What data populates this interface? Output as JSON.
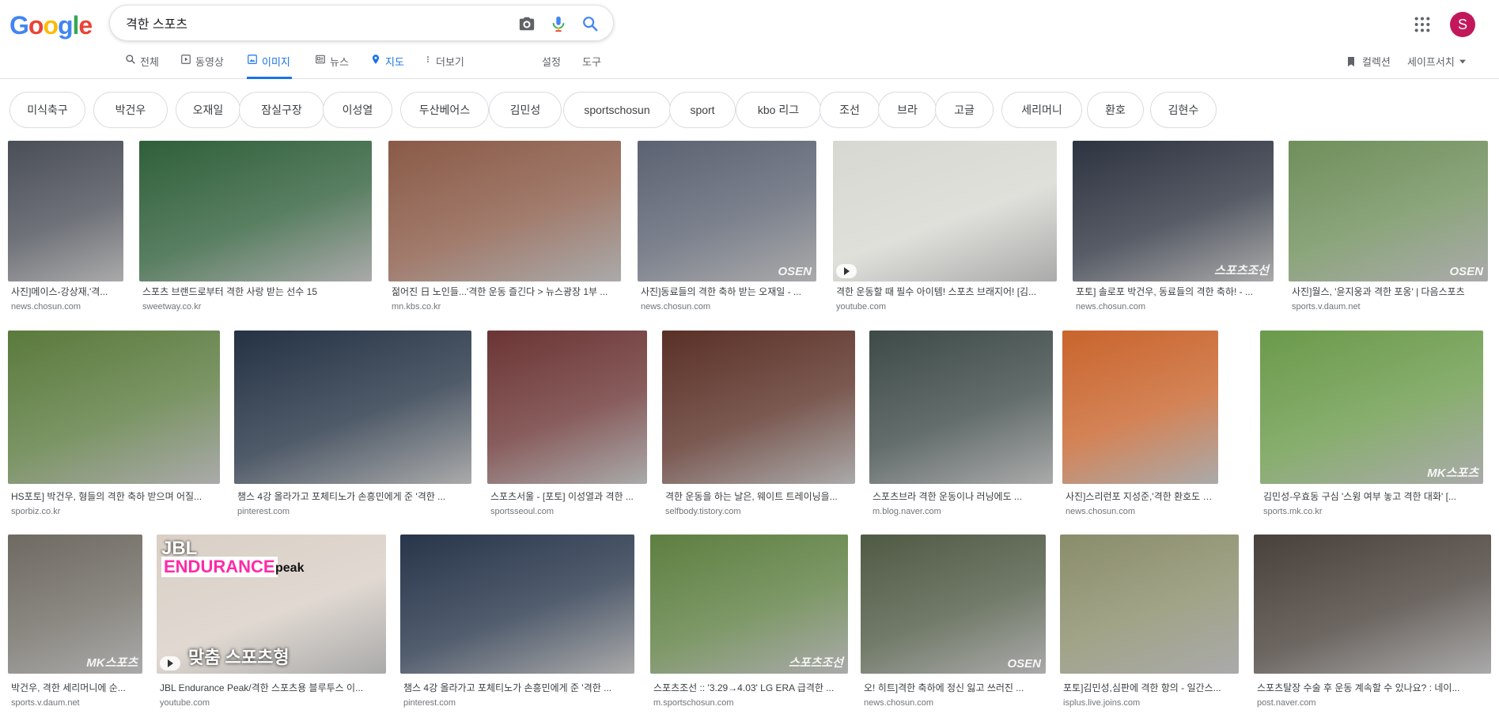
{
  "logo": [
    "G",
    "o",
    "o",
    "g",
    "l",
    "e"
  ],
  "search": {
    "query": "격한 스포츠"
  },
  "avatar_letter": "S",
  "tabs": [
    {
      "label": "전체",
      "icon": "search-icon"
    },
    {
      "label": "동영상",
      "icon": "video-icon"
    },
    {
      "label": "이미지",
      "icon": "image-icon",
      "active": true
    },
    {
      "label": "뉴스",
      "icon": "news-icon"
    },
    {
      "label": "지도",
      "icon": "map-pin-icon"
    },
    {
      "label": "더보기",
      "icon": "more-vert-icon"
    },
    {
      "label": "설정"
    },
    {
      "label": "도구"
    }
  ],
  "right_tools": {
    "collections": "컬렉션",
    "safesearch": "세이프서치"
  },
  "chips": [
    "미식축구",
    "박건우",
    "오재일",
    "잠실구장",
    "이성열",
    "두산베어스",
    "김민성",
    "sportschosun",
    "sport",
    "kbo 리그",
    "조선",
    "브라",
    "고글",
    "세리머니",
    "환호",
    "김현수"
  ],
  "results": [
    {
      "caption": "사진]메이스-강상재,'격...",
      "source": "news.chosun.com",
      "color": "#4a4e57"
    },
    {
      "caption": "스포츠 브랜드로부터 격한 사랑 받는 선수 15",
      "source": "sweetway.co.kr",
      "color": "#2f5f3a"
    },
    {
      "caption": "젊어진 日 노인들...'격한 운동 즐긴다 > 뉴스광장 1부 ...",
      "source": "mn.kbs.co.kr",
      "color": "#8a5a47"
    },
    {
      "caption": "사진]동료들의 격한 축하 받는 오재일 - ...",
      "source": "news.chosun.com",
      "color": "#5b6271",
      "badge": "OSEN"
    },
    {
      "caption": "격한 운동할 때 필수 아이템! 스포츠 브래지어! [김...",
      "source": "youtube.com",
      "color": "#d8d8d2",
      "video": true
    },
    {
      "caption": "포토] 솔로포 박건우, 동료들의 격한 축하! - ...",
      "source": "news.chosun.com",
      "color": "#2d3340",
      "badge": "스포츠조선"
    },
    {
      "caption": "사진]월스, '윤지웅과 격한 포옹' | 다음스포츠",
      "source": "sports.v.daum.net",
      "color": "#6f8f5b",
      "badge": "OSEN"
    },
    {
      "caption": "HS포토] 박건우, 형들의 격한 축하 받으며 어질...",
      "source": "sporbiz.co.kr",
      "color": "#5a7a3d"
    },
    {
      "caption": "챔스 4강 올라가고 포체티노가 손흥민에게 준 '격한 ...",
      "source": "pinterest.com",
      "color": "#243244"
    },
    {
      "caption": "스포츠서울 - [포토] 이성열과 격한 ...",
      "source": "sportsseoul.com",
      "color": "#6b3434"
    },
    {
      "caption": "격한 운동을 하는 날은, 웨이트 트레이닝을...",
      "source": "selfbody.tistory.com",
      "color": "#5a3026"
    },
    {
      "caption": "스포츠브라 격한 운동이나 러닝에도 ...",
      "source": "m.blog.naver.com",
      "color": "#3d4a48"
    },
    {
      "caption": "사진]스리런포 지성준,'격한 환호도 오케...",
      "source": "news.chosun.com",
      "color": "#c9642c"
    },
    {
      "caption": "김민성-우효동 구심 '스윙 여부 놓고 격한 대화' [...",
      "source": "sports.mk.co.kr",
      "color": "#6a9a4a",
      "badge": "MK스포츠"
    },
    {
      "caption": "박건우, 격한 세리머니에 순...",
      "source": "sports.v.daum.net",
      "color": "#6e6a62",
      "badge": "MK스포츠"
    },
    {
      "caption": "JBL Endurance Peak/격한 스포츠용 블루투스 이...",
      "source": "youtube.com",
      "color": "#d9cfc6",
      "video": true
    },
    {
      "caption": "챔스 4강 올라가고 포체티노가 손흥민에게 준 '격한 ...",
      "source": "pinterest.com",
      "color": "#27354a"
    },
    {
      "caption": "스포츠조선 :: '3.29→4.03' LG ERA 급격한 ...",
      "source": "m.sportschosun.com",
      "color": "#5d7f41",
      "badge": "스포츠조선"
    },
    {
      "caption": "오! 히트]격한 축하에 정신 잃고 쓰러진 ...",
      "source": "news.chosun.com",
      "color": "#4f5a44",
      "badge": "OSEN"
    },
    {
      "caption": "포토]김민성,심판에 격한 항의 - 일간스...",
      "source": "isplus.live.joins.com",
      "color": "#8a8d6a"
    },
    {
      "caption": "스포츠탈장 수술 후 운동 계속할 수 있나요? : 네이...",
      "source": "post.naver.com",
      "color": "#48403a"
    }
  ],
  "overlay_text": {
    "jbl_line1": "JBL",
    "jbl_line2": "ENDURANCE",
    "jbl_peak": "peak",
    "jbl_bottom": "맞춤 스포츠형"
  }
}
